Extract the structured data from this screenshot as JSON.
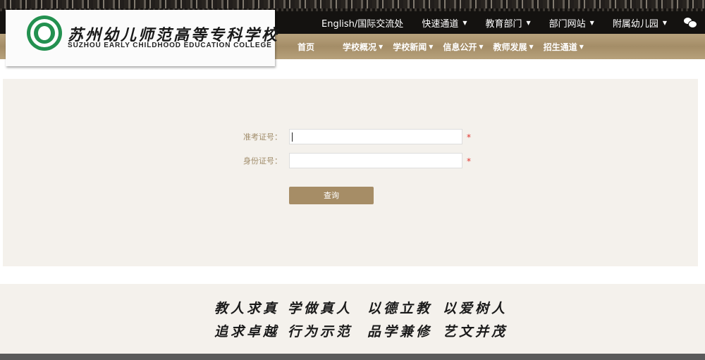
{
  "logo": {
    "name_cn": "苏州幼儿师范高等专科学校",
    "name_en": "SUZHOU EARLY CHILDHOOD EDUCATION COLLEGE"
  },
  "top_nav": [
    {
      "label": "English/国际交流处"
    },
    {
      "label": "快速通道",
      "caret": "▼"
    },
    {
      "label": "教育部门",
      "caret": "▼"
    },
    {
      "label": "部门网站",
      "caret": "▼"
    },
    {
      "label": "附属幼儿园",
      "caret": "▼"
    }
  ],
  "main_nav": [
    {
      "label": "首页"
    },
    {
      "label": "学校概况",
      "caret": "▼"
    },
    {
      "label": "学校新闻",
      "caret": "▼"
    },
    {
      "label": "信息公开",
      "caret": "▼"
    },
    {
      "label": "教师发展",
      "caret": "▼"
    },
    {
      "label": "招生通道",
      "caret": "▼"
    }
  ],
  "form": {
    "exam_id_label": "准考证号：",
    "exam_id_value": "",
    "id_card_label": "身份证号：",
    "id_card_value": "",
    "required_mark": "*",
    "submit_label": "查询"
  },
  "footer": {
    "mottos": [
      "教人求真",
      "学做真人",
      "以德立教",
      "以爱树人",
      "追求卓越",
      "行为示范",
      "品学兼修",
      "艺文并茂"
    ]
  },
  "colors": {
    "nav_gold": "#a68d66",
    "panel_bg": "#f4f1ec",
    "required_red": "#e0312c",
    "label_color": "#a08c6a"
  },
  "icons": [
    "wechat-icon",
    "dropdown-caret-icon"
  ]
}
